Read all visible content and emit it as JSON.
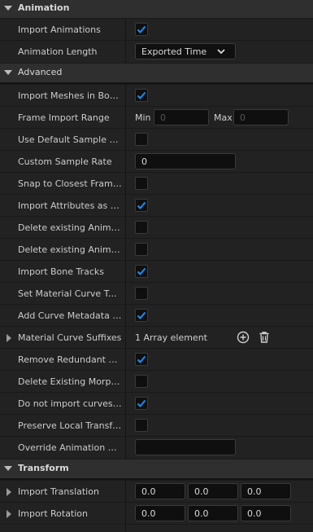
{
  "sections": {
    "animation": {
      "title": "Animation"
    },
    "advanced": {
      "title": "Advanced"
    },
    "transform": {
      "title": "Transform"
    }
  },
  "animation_rows": {
    "import_animations": {
      "label": "Import Animations",
      "checked": true
    },
    "animation_length": {
      "label": "Animation Length",
      "value": "Exported Time"
    }
  },
  "advanced_rows": {
    "import_meshes": {
      "label": "Import Meshes in Bone...",
      "checked": true
    },
    "frame_import_range": {
      "label": "Frame Import Range",
      "min_label": "Min",
      "min_value": "0",
      "max_label": "Max",
      "max_value": "0"
    },
    "use_default_sample_rate": {
      "label": "Use Default Sample Rate",
      "checked": false
    },
    "custom_sample_rate": {
      "label": "Custom Sample Rate",
      "value": "0"
    },
    "snap_closest_frame": {
      "label": "Snap to Closest Frame...",
      "checked": false
    },
    "import_attributes": {
      "label": "Import Attributes as Cur...",
      "checked": true
    },
    "delete_existing_1": {
      "label": "Delete existing Animatio...",
      "checked": false
    },
    "delete_existing_2": {
      "label": "Delete existing Animatio...",
      "checked": false
    },
    "import_bone_tracks": {
      "label": "Import Bone Tracks",
      "checked": true
    },
    "set_material_curve_type": {
      "label": "Set Material Curve Type",
      "checked": false
    },
    "add_curve_metadata": {
      "label": "Add Curve Metadata to...",
      "checked": true
    },
    "material_curve_suffixes": {
      "label": "Material Curve Suffixes",
      "value": "1 Array element"
    },
    "remove_redundant_keys": {
      "label": "Remove Redundant Keys",
      "checked": true
    },
    "delete_existing_morph": {
      "label": "Delete Existing Morph T...",
      "checked": false
    },
    "do_not_import_curves": {
      "label": "Do not import curves wit...",
      "checked": true
    },
    "preserve_local_transform": {
      "label": "Preserve Local Transform",
      "checked": false
    },
    "override_animation_name": {
      "label": "Override Animation Name",
      "value": ""
    }
  },
  "transform_rows": {
    "import_translation": {
      "label": "Import Translation",
      "x": "0.0",
      "y": "0.0",
      "z": "0.0"
    },
    "import_rotation": {
      "label": "Import Rotation",
      "x": "0.0",
      "y": "0.0",
      "z": "0.0"
    }
  },
  "icons": {
    "checkmark": "check-icon",
    "dropdown": "chevron-down-icon",
    "add": "plus-circle-icon",
    "delete": "trash-icon",
    "expand": "caret-right-icon",
    "collapse": "caret-down-icon"
  },
  "colors": {
    "accent": "#1f8ef1",
    "header_bg": "#2f2f2f",
    "row_bg": "#222222",
    "field_bg": "#0f0f0f"
  }
}
